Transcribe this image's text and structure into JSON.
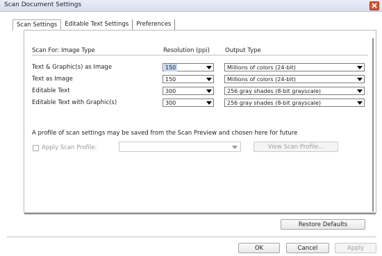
{
  "window": {
    "title": "Scan Document Settings"
  },
  "tabs": [
    {
      "label": "Scan Settings",
      "active": true
    },
    {
      "label": "Editable Text Settings",
      "active": false
    },
    {
      "label": "Preferences",
      "active": false
    }
  ],
  "table": {
    "headers": {
      "scan_for": "Scan For: Image Type",
      "resolution": "Resolution (ppi)",
      "output_type": "Output Type"
    },
    "rows": [
      {
        "label": "Text & Graphic(s) as Image",
        "resolution": "150",
        "output": "Millions of colors (24-bit)"
      },
      {
        "label": "Text as Image",
        "resolution": "150",
        "output": "Millions of colors (24-bit)"
      },
      {
        "label": "Editable Text",
        "resolution": "300",
        "output": "256 gray shades (8-bit grayscale)"
      },
      {
        "label": "Editable Text with Graphic(s)",
        "resolution": "300",
        "output": "256 gray shades (8-bit grayscale)"
      }
    ]
  },
  "profile": {
    "info_text": "A profile of scan settings may be saved from the Scan Preview and chosen here for future",
    "apply_label": "Apply Scan Profile:",
    "apply_checked": false,
    "selected_profile": "",
    "view_button": "View Scan Profile..."
  },
  "buttons": {
    "restore": "Restore Defaults",
    "ok": "OK",
    "cancel": "Cancel",
    "apply": "Apply"
  },
  "colors": {
    "close_button": "#d9563a",
    "selection_highlight": "#c8d8f2"
  },
  "icons": {
    "close": "close-icon",
    "dropdown": "chevron-down-icon"
  }
}
